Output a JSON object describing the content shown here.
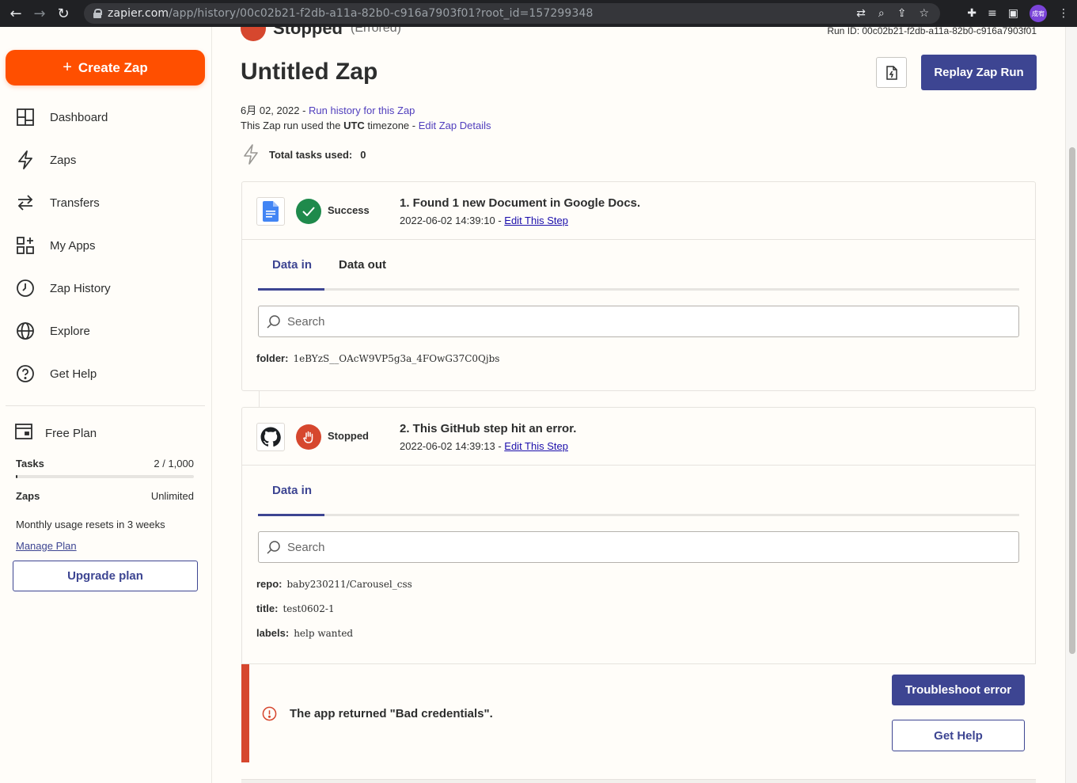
{
  "browser": {
    "url_host": "zapier.com",
    "url_path": "/app/history/00c02b21-f2db-a11a-82b0-c916a7903f01?root_id=157299348",
    "avatar_text": "成宥"
  },
  "sidebar": {
    "create_label": "Create Zap",
    "items": [
      {
        "label": "Dashboard",
        "icon": "dashboard-icon"
      },
      {
        "label": "Zaps",
        "icon": "lightning-icon"
      },
      {
        "label": "Transfers",
        "icon": "transfer-arrows-icon"
      },
      {
        "label": "My Apps",
        "icon": "apps-grid-icon"
      },
      {
        "label": "Zap History",
        "icon": "clock-icon"
      },
      {
        "label": "Explore",
        "icon": "globe-icon"
      },
      {
        "label": "Get Help",
        "icon": "help-icon"
      }
    ],
    "plan": {
      "title": "Free Plan",
      "tasks_label": "Tasks",
      "tasks_value": "2 / 1,000",
      "tasks_fraction": 0.002,
      "zaps_label": "Zaps",
      "zaps_value": "Unlimited",
      "resets_text": "Monthly usage resets in 3 weeks",
      "manage_label": "Manage Plan",
      "upgrade_label": "Upgrade plan"
    }
  },
  "header": {
    "status": "Stopped",
    "status_sub": "(Errored)",
    "run_id": "Run ID: 00c02b21-f2db-a11a-82b0-c916a7903f01",
    "title": "Untitled Zap",
    "replay_label": "Replay Zap Run",
    "date": "6月 02, 2022",
    "date_sep": " - ",
    "run_history_link": "Run history for this Zap",
    "tz_prefix": "This Zap run used the ",
    "tz_value": "UTC",
    "tz_suffix": " timezone - ",
    "edit_details_link": "Edit Zap Details",
    "tasks_used_label": "Total tasks used:",
    "tasks_used_value": "0"
  },
  "steps": [
    {
      "status": "Success",
      "title": "1. Found 1 new Document in Google Docs.",
      "timestamp": "2022-06-02 14:39:10",
      "edit_label": "Edit This Step",
      "tabs": [
        "Data in",
        "Data out"
      ],
      "search_placeholder": "Search",
      "fields": [
        {
          "key": "folder:",
          "value": "1eBYzS__OAcW9VP5g3a_4FOwG37C0Qjbs"
        }
      ]
    },
    {
      "status": "Stopped",
      "title": "2. This GitHub step hit an error.",
      "timestamp": "2022-06-02 14:39:13",
      "edit_label": "Edit This Step",
      "tabs": [
        "Data in"
      ],
      "search_placeholder": "Search",
      "fields": [
        {
          "key": "repo:",
          "value": "baby230211/Carousel_css"
        },
        {
          "key": "title:",
          "value": "test0602-1"
        },
        {
          "key": "labels:",
          "value": "help wanted"
        }
      ],
      "error": {
        "message": "The app returned \"Bad credentials\".",
        "troubleshoot_label": "Troubleshoot error",
        "help_label": "Get Help"
      }
    }
  ],
  "colors": {
    "brand_orange": "#ff4f00",
    "primary_blue": "#3d4592",
    "success_green": "#1f8a4c",
    "error_red": "#d6472e",
    "link_purple": "#503ebd"
  }
}
